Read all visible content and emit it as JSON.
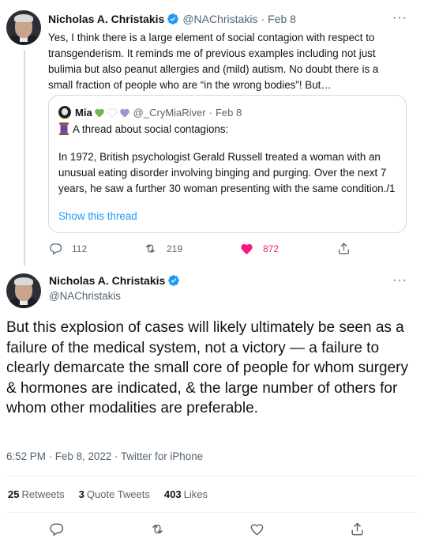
{
  "tweet1": {
    "name": "Nicholas A. Christakis",
    "handle": "@NAChristakis",
    "separator": "·",
    "date": "Feb 8",
    "more": "···",
    "text": "Yes, I think there is a large element of social contagion with respect to transgenderism. It reminds me of previous examples including not just bulimia but also peanut allergies and (mild) autism. No doubt there is a small fraction of people who are “in the wrong bodies”! But…",
    "quote": {
      "name": "Mia",
      "handle": "@_CryMiaRiver",
      "separator": "·",
      "date": "Feb 8",
      "first_line": "A thread about social contagions:",
      "body": "In 1972, British psychologist Gerald Russell treated a woman with an unusual eating disorder involving binging and purging. Over the next 7 years, he saw a further 30 woman presenting with the same condition./1",
      "link": "Show this thread",
      "hearts": [
        "#77b255",
        "#ffffff",
        "#aa8ed6"
      ]
    },
    "actions": {
      "replies": "112",
      "retweets": "219",
      "likes": "872"
    }
  },
  "tweet2": {
    "name": "Nicholas A. Christakis",
    "handle": "@NAChristakis",
    "more": "···",
    "text": "But this explosion of cases will likely ultimately be seen as a failure of the medical system, not a victory — a failure to clearly demarcate the small core of people for whom surgery & hormones are indicated, & the large number of others for whom other modalities are preferable.",
    "meta": "6:52 PM · Feb 8, 2022 · Twitter for iPhone",
    "stats": {
      "retweets_count": "25",
      "retweets_label": "Retweets",
      "quotes_count": "3",
      "quotes_label": "Quote Tweets",
      "likes_count": "403",
      "likes_label": "Likes"
    }
  },
  "colors": {
    "accent": "#1d9bf0",
    "like": "#f91880",
    "secondary_text": "#536471"
  }
}
